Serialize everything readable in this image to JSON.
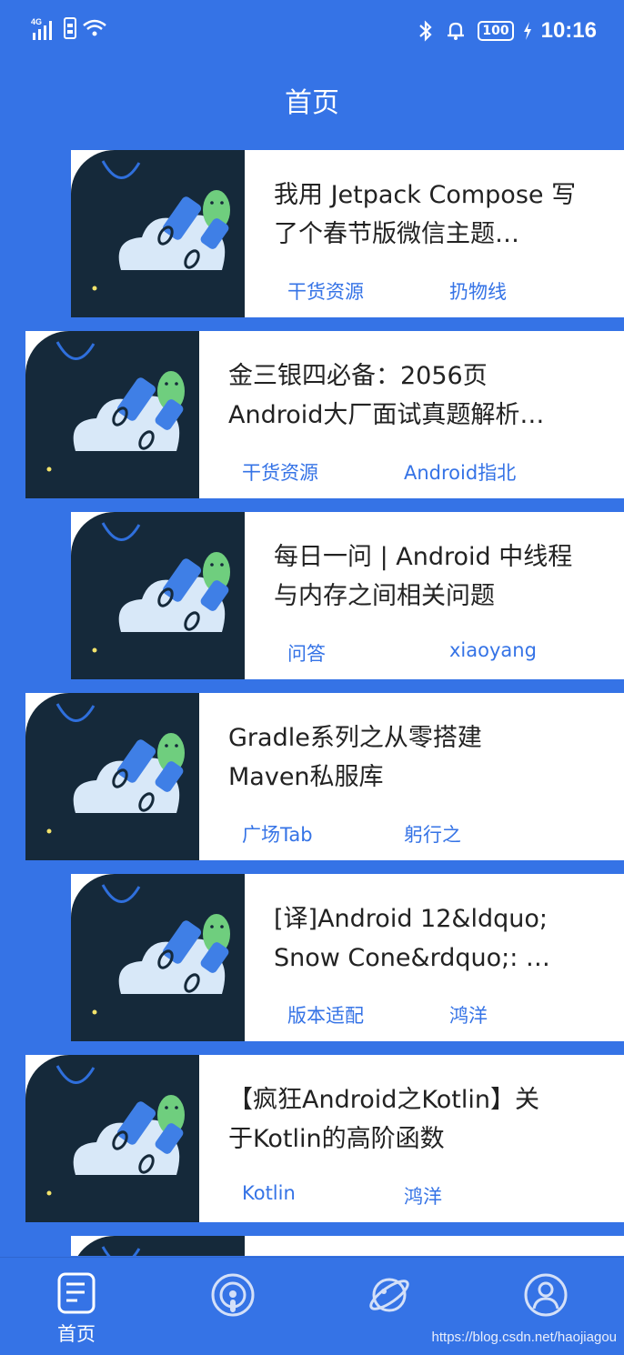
{
  "status_bar": {
    "network": "4G",
    "battery": "100",
    "time": "10:16"
  },
  "header": {
    "title": "首页"
  },
  "articles": [
    {
      "title": "我用 Jetpack Compose 写了个春节版微信主题…",
      "category": "干货资源",
      "author": "扔物线"
    },
    {
      "title": "金三银四必备：2056页 Android大厂面试真题解析…",
      "category": "干货资源",
      "author": "Android指北"
    },
    {
      "title": "每日一问 | Android 中线程与内存之间相关问题",
      "category": "问答",
      "author": "xiaoyang"
    },
    {
      "title": "Gradle系列之从零搭建 Maven私服库",
      "category": "广场Tab",
      "author": "躬行之"
    },
    {
      "title": "[译]Android 12&ldquo; Snow Cone&rdquo;: …",
      "category": "版本适配",
      "author": "鸿洋"
    },
    {
      "title": "【疯狂Android之Kotlin】关于Kotlin的高阶函数",
      "category": "Kotlin",
      "author": "鸿洋"
    }
  ],
  "bottom_nav": {
    "items": [
      {
        "label": "首页",
        "icon": "document-icon"
      },
      {
        "label": "",
        "icon": "podcast-icon"
      },
      {
        "label": "",
        "icon": "planet-icon"
      },
      {
        "label": "",
        "icon": "profile-icon"
      }
    ]
  },
  "watermark": "https://blog.csdn.net/haojiagou",
  "colors": {
    "primary": "#3573e6",
    "thumb_bg": "#15293a",
    "card_bg": "#ffffff"
  }
}
